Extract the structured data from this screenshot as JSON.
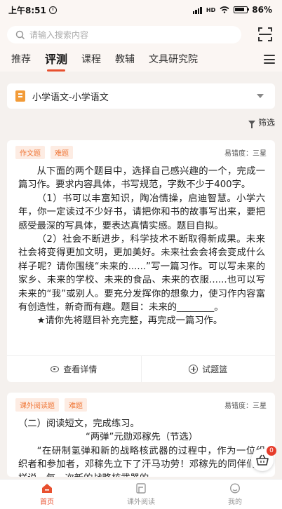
{
  "status_bar": {
    "time": "上午8:51",
    "signal": "HD",
    "battery": "86%"
  },
  "search": {
    "placeholder": "请输入搜索内容"
  },
  "tabs": [
    {
      "label": "推荐",
      "active": false
    },
    {
      "label": "评测",
      "active": true
    },
    {
      "label": "课程",
      "active": false
    },
    {
      "label": "教辅",
      "active": false
    },
    {
      "label": "文具研究院",
      "active": false
    }
  ],
  "subject_select": {
    "value": "小学语文-小学语文"
  },
  "filter": {
    "label": "筛选"
  },
  "cards": [
    {
      "tags": [
        "作文题",
        "难题"
      ],
      "difficulty": "易错度：三星",
      "paragraphs": [
        "从下面的两个题目中，选择自己感兴趣的一个，完成一篇习作。要求内容具体，书写规范，字数不少于400字。",
        "（1）书可以丰富知识，陶冶情操，启迪智慧。小学六年，你一定读过不少好书，请把你和书的故事写出来，要把感受最深的写具体，要表达真情实感。题目自拟。",
        "（2）社会不断进步，科学技术不断取得新成果。未来社会将变得更加文明，更加美好。未来社会会将会变成什么样子呢？请你围绕“未来的......”写一篇习作。可以写未来的家乡、未来的学校、未来的食品、未来的衣服......也可以写未来的“我”或别人。要充分发挥你的想象力，使习作内容富有创造性，新奇而有趣。题目：未来的________。",
        "★请你先将题目补充完整，再完成一篇习作。"
      ],
      "actions": {
        "detail": "查看详情",
        "basket": "试题篮"
      }
    },
    {
      "tags": [
        "课外阅读题",
        "难题"
      ],
      "difficulty": "易错度：三星",
      "paragraphs": [
        "（二）阅读短文，完成练习。",
        "“两弹”元勋邓稼先（节选）",
        "“在研制氢弹和新的战略核武器的过程中，作为一位组织者和参加者，邓稼先立下了汗马功劳！邓稼先的同伴们这样说。每一次新的战略核武器的"
      ]
    }
  ],
  "basket_badge": "0",
  "bottom_nav": [
    {
      "label": "首页",
      "active": true
    },
    {
      "label": "课外阅读",
      "active": false
    },
    {
      "label": "我的",
      "active": false
    }
  ],
  "colors": {
    "accent": "#e8502f",
    "tag_text": "#f07a3c",
    "tag_bg": "#fdece3"
  }
}
